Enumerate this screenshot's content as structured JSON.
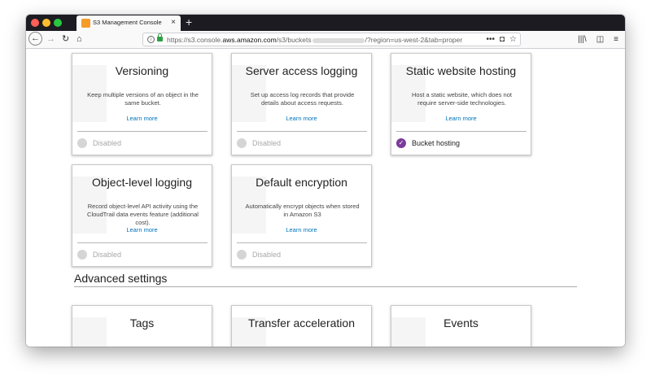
{
  "browser": {
    "tab_title": "S3 Management Console",
    "tab_close": "×",
    "new_tab": "+",
    "nav": {
      "back": "←",
      "forward": "→",
      "reload": "↻",
      "home": "⌂"
    },
    "url": {
      "info": "i",
      "prefix": "https://s3.console.",
      "domain": "aws.amazon.com",
      "path": "/s3/buckets",
      "suffix": "/?region=us-west-2&tab=proper",
      "actions": {
        "more": "•••",
        "pocket": "◘",
        "bookmark": "☆"
      }
    },
    "right_icons": {
      "library": "|||\\",
      "sidebar": "◫",
      "menu": "≡"
    },
    "colors": {
      "titlebar": "#1c1b22",
      "close": "#fe5f57",
      "minimize": "#febc2e",
      "zoom": "#28c840"
    }
  },
  "properties": {
    "cards": [
      {
        "title": "Versioning",
        "description": "Keep multiple versions of an object in the same bucket.",
        "link": "Learn more",
        "status": "Disabled",
        "enabled": false
      },
      {
        "title": "Server access logging",
        "description": "Set up access log records that provide details about access requests.",
        "link": "Learn more",
        "status": "Disabled",
        "enabled": false
      },
      {
        "title": "Static website hosting",
        "description": "Host a static website, which does not require server-side technologies.",
        "link": "Learn more",
        "status": "Bucket hosting",
        "enabled": true
      },
      {
        "title": "Object-level logging",
        "description": "Record object-level API activity using the CloudTrail data events feature (additional cost).",
        "link": "Learn more",
        "status": "Disabled",
        "enabled": false
      },
      {
        "title": "Default encryption",
        "description": "Automatically encrypt objects when stored in Amazon S3",
        "link": "Learn more",
        "status": "Disabled",
        "enabled": false
      }
    ],
    "advanced": {
      "heading": "Advanced settings",
      "cards": [
        {
          "title": "Tags"
        },
        {
          "title": "Transfer acceleration"
        },
        {
          "title": "Events"
        }
      ]
    },
    "colors": {
      "link": "#0073bb",
      "enabled": "#7b3a9b",
      "disabled": "#d5d5d5"
    }
  }
}
